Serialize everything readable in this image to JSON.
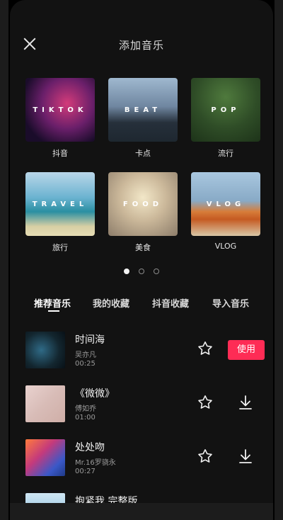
{
  "header": {
    "title": "添加音乐"
  },
  "categories": [
    {
      "id": "tiktok",
      "word": "TIKTOK",
      "label": "抖音"
    },
    {
      "id": "beat",
      "word": "BEAT",
      "label": "卡点"
    },
    {
      "id": "pop",
      "word": "POP",
      "label": "流行"
    },
    {
      "id": "travel",
      "word": "TRAVEL",
      "label": "旅行"
    },
    {
      "id": "food",
      "word": "FOOD",
      "label": "美食"
    },
    {
      "id": "vlog",
      "word": "VLOG",
      "label": "VLOG"
    }
  ],
  "pager": {
    "active_index": 0,
    "count": 3
  },
  "tabs": [
    {
      "label": "推荐音乐",
      "active": true
    },
    {
      "label": "我的收藏",
      "active": false
    },
    {
      "label": "抖音收藏",
      "active": false
    },
    {
      "label": "导入音乐",
      "active": false
    }
  ],
  "songs": [
    {
      "title": "时间海",
      "artist": "吴亦凡",
      "duration": "00:25",
      "action": "使用"
    },
    {
      "title": "《微微》",
      "artist": "傅如乔",
      "duration": "01:00",
      "action": "download"
    },
    {
      "title": "处处吻",
      "artist": "Mr.16罗骁永",
      "duration": "00:27",
      "action": "download"
    },
    {
      "title": "抱紧我 完整版",
      "artist": "",
      "duration": "",
      "action": "download"
    }
  ],
  "colors": {
    "accent": "#fe2c55",
    "background": "#121212"
  }
}
